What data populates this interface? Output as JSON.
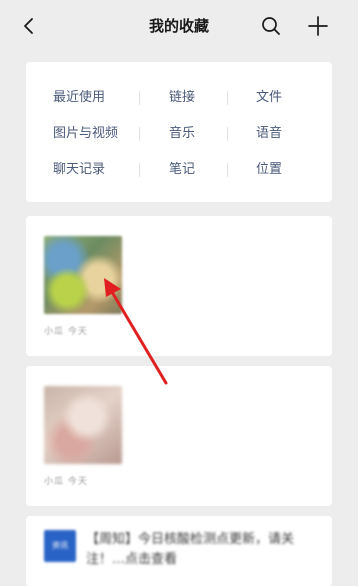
{
  "nav": {
    "title": "我的收藏",
    "back_icon": "chevron-left-icon",
    "search_icon": "search-icon",
    "add_icon": "plus-icon"
  },
  "filter": {
    "rows": [
      [
        "最近使用",
        "链接",
        "文件"
      ],
      [
        "图片与视频",
        "音乐",
        "语音"
      ],
      [
        "聊天记录",
        "笔记",
        "位置"
      ]
    ]
  },
  "favorites": [
    {
      "type": "image",
      "meta": "小瓜  今天"
    },
    {
      "type": "image",
      "meta": "小瓜  今天"
    },
    {
      "type": "article",
      "icon_text": "资讯",
      "title": "【周知】今日核酸检测点更新，请关注！…点击查看"
    }
  ],
  "colors": {
    "background": "#ededed",
    "card": "#ffffff",
    "filter_text": "#4a5a7a",
    "annotation_arrow": "#e02020"
  }
}
